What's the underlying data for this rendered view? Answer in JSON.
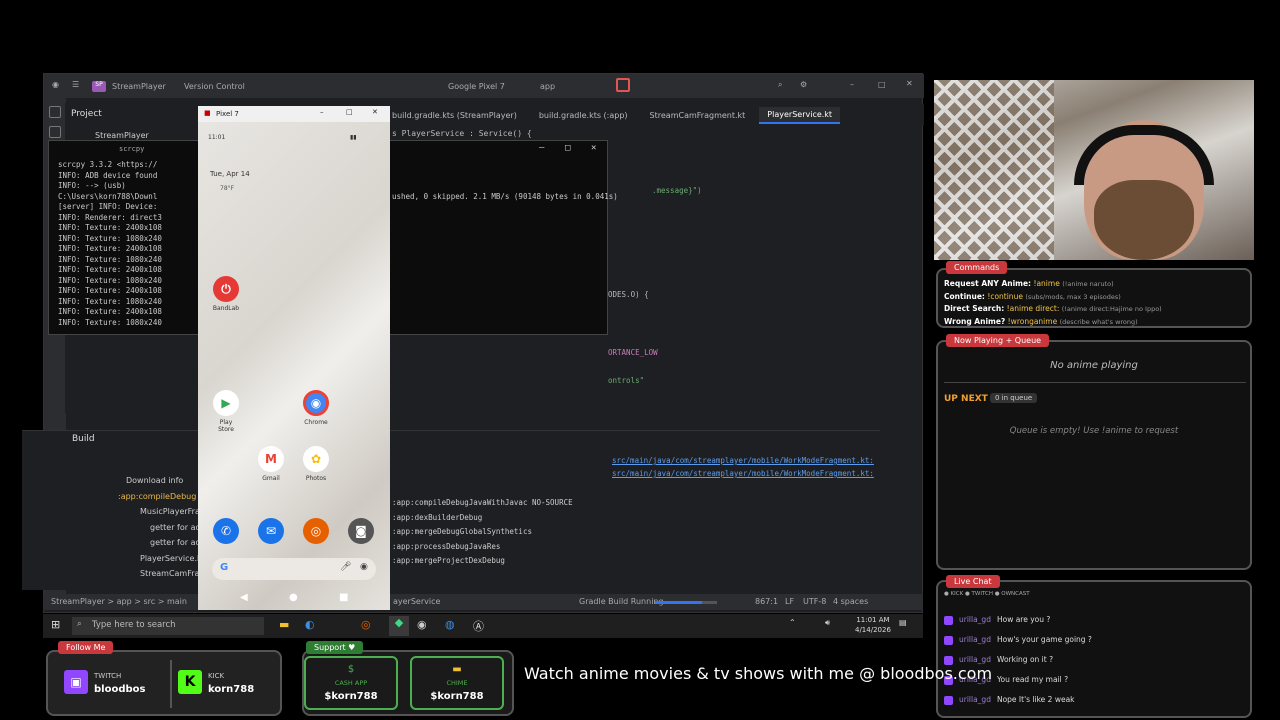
{
  "ide": {
    "project_name": "StreamPlayer",
    "vcs": "Version Control",
    "device": "Google Pixel 7",
    "run_config": "app",
    "tabs": [
      "build.gradle.kts (StreamPlayer)",
      "build.gradle.kts (:app)",
      "StreamCamFragment.kt",
      "PlayerService.kt"
    ],
    "active_tab": "PlayerService.kt",
    "project_panel_title": "Project",
    "project_root": "StreamPlayer",
    "code_header": "s PlayerService : Service() {",
    "code_lines": [
      ".message}\")",
      "ODES.O) {",
      "ORTANCE_LOW",
      "ontrols\""
    ],
    "build_title": "Build",
    "build_tree": [
      "Download info",
      ":app:compileDebug",
      "MusicPlayerFrag",
      "getter for ad",
      "getter for ad",
      "PlayerService.kt",
      "StreamCamFragm"
    ],
    "build_output": [
      ":app:compileDebugJavaWithJavac NO-SOURCE",
      ":app:dexBuilderDebug",
      ":app:mergeDebugGlobalSynthetics",
      ":app:processDebugJavaRes",
      ":app:mergeProjectDexDebug"
    ],
    "build_links": [
      "src/main/java/com/streamplayer/mobile/WorkModeFragment.kt:"
    ],
    "status_path": "StreamPlayer > app > src > main",
    "status_breadcrumb_end": "ayerService",
    "status_task": "Gradle Build Running",
    "build_progress": 0.75,
    "cursor_pos": "867:1",
    "line_sep": "LF",
    "encoding": "UTF-8",
    "indent": "4 spaces"
  },
  "cmd": {
    "title": "scrcpy",
    "lines": [
      "scrcpy 3.3.2 <https://",
      "INFO: ADB device found",
      "INFO:     -->  (usb)",
      "C:\\Users\\korn788\\Downl",
      "[server] INFO: Device:",
      "INFO: Renderer: direct3",
      "INFO: Texture: 2400x108",
      "INFO: Texture: 1080x240",
      "INFO: Texture: 2400x108",
      "INFO: Texture: 1080x240",
      "INFO: Texture: 2400x108",
      "INFO: Texture: 1080x240",
      "INFO: Texture: 2400x108",
      "INFO: Texture: 1080x240",
      "INFO: Texture: 2400x108",
      "INFO: Texture: 1080x240"
    ],
    "right_line": "ushed, 0 skipped. 2.1 MB/s (90148 bytes in 0.041s)"
  },
  "phone": {
    "window_title": "Pixel 7",
    "status_time": "11:01",
    "date": "Tue, Apr 14",
    "weather": "78°F",
    "apps": [
      {
        "name": "BandLab",
        "color": "#e53935",
        "glyph": "⏻"
      },
      {
        "name": "Play Store",
        "color": "#ffffff",
        "glyph": "▶"
      },
      {
        "name": "Chrome",
        "color": "#4285f4",
        "glyph": "◉"
      },
      {
        "name": "Gmail",
        "color": "#ffffff",
        "glyph": "M"
      },
      {
        "name": "Photos",
        "color": "#ffffff",
        "glyph": "✿"
      }
    ],
    "search_glyph": "G"
  },
  "taskbar": {
    "search_placeholder": "Type here to search",
    "time": "11:01 AM",
    "date": "4/14/2026"
  },
  "overlay": {
    "commands_tag": "Commands",
    "commands": [
      {
        "label": "Request ANY Anime:",
        "cmd": "!anime",
        "desc": "(!anime naruto)"
      },
      {
        "label": "Continue:",
        "cmd": "!continue",
        "desc": "(subs/mods, max 3 episodes)"
      },
      {
        "label": "Direct Search:",
        "cmd": "!anime direct:",
        "desc": "(!anime direct:Hajime no Ippo)"
      },
      {
        "label": "Wrong Anime?",
        "cmd": "!wronganime",
        "desc": "(describe what's wrong)"
      }
    ],
    "now_playing_tag": "Now Playing + Queue",
    "now_playing_text": "No anime playing",
    "up_next": "UP NEXT",
    "queue_badge": "0 in queue",
    "queue_empty": "Queue is empty! Use !anime to request",
    "chat_tag": "Live Chat",
    "chat_platforms": "● KICK  ● TWITCH  ● OWNCAST",
    "chat": [
      {
        "user": "urilla_gd",
        "msg": "How are you ?"
      },
      {
        "user": "urilla_gd",
        "msg": "How's your game going ?"
      },
      {
        "user": "urilla_gd",
        "msg": "Working on it ?"
      },
      {
        "user": "urilla_gd",
        "msg": "You read my mail ?"
      },
      {
        "user": "urilla_gd",
        "msg": "Nope It's like 2 weak"
      }
    ]
  },
  "bottom": {
    "follow_tag": "Follow Me",
    "twitch_label": "TWITCH",
    "twitch_handle": "bloodbos",
    "kick_label": "KICK",
    "kick_handle": "korn788",
    "support_tag": "Support ♥",
    "cashapp_label": "CASH APP",
    "cashapp_handle": "$korn788",
    "chime_label": "CHIME",
    "chime_handle": "$korn788",
    "marquee": "Watch anime movies & tv shows with me @ bloodbos.com"
  }
}
